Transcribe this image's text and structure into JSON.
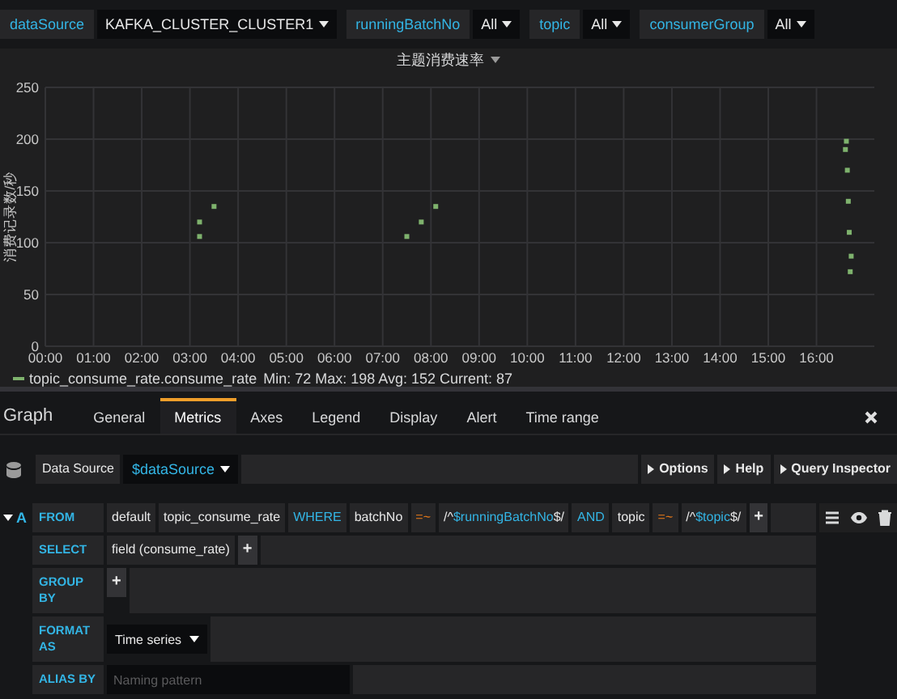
{
  "variables": [
    {
      "label": "dataSource",
      "value": "KAFKA_CLUSTER_CLUSTER1"
    },
    {
      "label": "runningBatchNo",
      "value": "All"
    },
    {
      "label": "topic",
      "value": "All"
    },
    {
      "label": "consumerGroup",
      "value": "All"
    }
  ],
  "panel": {
    "title": "主题消费速率",
    "chart_data": {
      "type": "scatter",
      "ylabel": "消费记录数/秒",
      "x": [
        3.2,
        3.2,
        3.5,
        7.5,
        7.8,
        8.1,
        16.6,
        16.62,
        16.64,
        16.66,
        16.68,
        16.7,
        16.72
      ],
      "series": [
        {
          "name": "topic_consume_rate.consume_rate",
          "color": "#7eb26d",
          "values": [
            106,
            120,
            135,
            106,
            120,
            135,
            190,
            198,
            170,
            140,
            110,
            72,
            87
          ]
        }
      ],
      "xlim": [
        0,
        17.2
      ],
      "ylim": [
        0,
        250
      ],
      "grid": true,
      "xticks": [
        {
          "value": 0,
          "label": "00:00"
        },
        {
          "value": 1,
          "label": "01:00"
        },
        {
          "value": 2,
          "label": "02:00"
        },
        {
          "value": 3,
          "label": "03:00"
        },
        {
          "value": 4,
          "label": "04:00"
        },
        {
          "value": 5,
          "label": "05:00"
        },
        {
          "value": 6,
          "label": "06:00"
        },
        {
          "value": 7,
          "label": "07:00"
        },
        {
          "value": 8,
          "label": "08:00"
        },
        {
          "value": 9,
          "label": "09:00"
        },
        {
          "value": 10,
          "label": "10:00"
        },
        {
          "value": 11,
          "label": "11:00"
        },
        {
          "value": 12,
          "label": "12:00"
        },
        {
          "value": 13,
          "label": "13:00"
        },
        {
          "value": 14,
          "label": "14:00"
        },
        {
          "value": 15,
          "label": "15:00"
        },
        {
          "value": 16,
          "label": "16:00"
        }
      ],
      "yticks": [
        0,
        50,
        100,
        150,
        200,
        250
      ]
    },
    "legend_stats": "Min: 72 Max: 198 Avg: 152 Current: 87"
  },
  "editor": {
    "title": "Graph",
    "tabs": [
      {
        "label": "General",
        "selected": false
      },
      {
        "label": "Metrics",
        "selected": true
      },
      {
        "label": "Axes",
        "selected": false
      },
      {
        "label": "Legend",
        "selected": false
      },
      {
        "label": "Display",
        "selected": false
      },
      {
        "label": "Alert",
        "selected": false
      },
      {
        "label": "Time range",
        "selected": false
      }
    ],
    "datasource": {
      "label": "Data Source",
      "value": "$dataSource",
      "buttons": [
        "Options",
        "Help",
        "Query Inspector"
      ]
    },
    "query": {
      "ref": "A",
      "rows": [
        {
          "label": "FROM",
          "segments": [
            {
              "kind": "plain",
              "text": "default"
            },
            {
              "kind": "plain",
              "text": "topic_consume_rate"
            },
            {
              "kind": "keyword",
              "text": "WHERE"
            },
            {
              "kind": "plain",
              "text": "batchNo"
            },
            {
              "kind": "operator",
              "text": "=~"
            },
            {
              "kind": "regex",
              "prefix": "/^",
              "variable": "$runningBatchNo",
              "suffix": "$/"
            },
            {
              "kind": "keyword",
              "text": "AND"
            },
            {
              "kind": "plain",
              "text": "topic"
            },
            {
              "kind": "operator",
              "text": "=~"
            },
            {
              "kind": "regex",
              "prefix": "/^",
              "variable": "$topic",
              "suffix": "$/"
            },
            {
              "kind": "add",
              "text": "+"
            }
          ]
        },
        {
          "label": "SELECT",
          "segments": [
            {
              "kind": "plain",
              "text": "field (consume_rate)"
            },
            {
              "kind": "add",
              "text": "+"
            }
          ]
        },
        {
          "label": "GROUP BY",
          "segments": [
            {
              "kind": "add",
              "text": "+"
            }
          ]
        },
        {
          "label": "FORMAT AS",
          "segments": [
            {
              "kind": "select",
              "text": "Time series"
            }
          ]
        },
        {
          "label": "ALIAS BY",
          "segments": [
            {
              "kind": "input",
              "placeholder": "Naming pattern"
            }
          ]
        }
      ]
    }
  }
}
